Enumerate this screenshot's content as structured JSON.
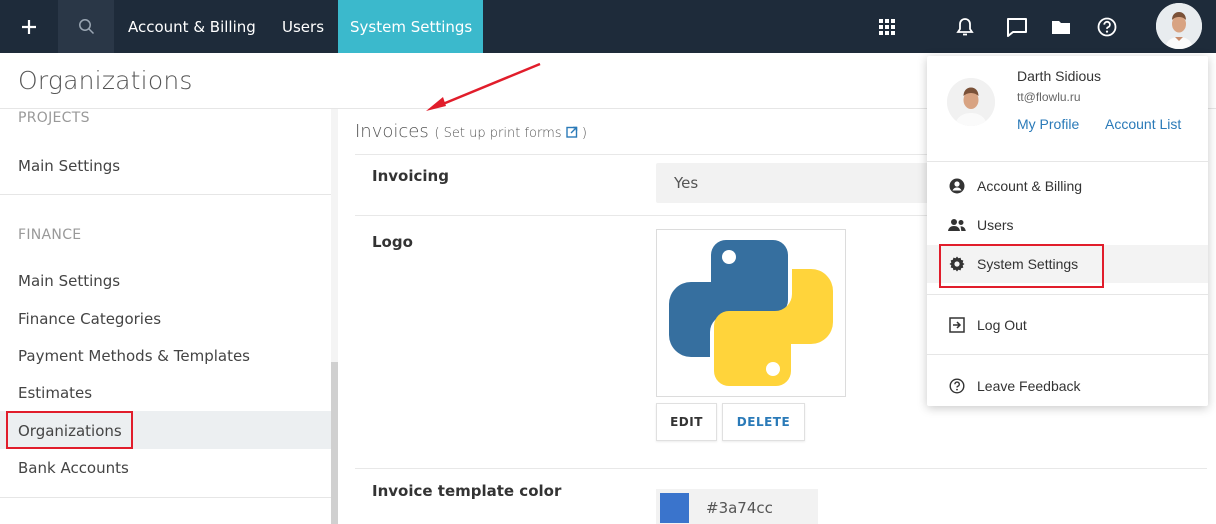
{
  "topbar": {
    "nav": [
      {
        "label": "Account & Billing"
      },
      {
        "label": "Users"
      },
      {
        "label": "System Settings",
        "active": true
      }
    ],
    "icons": [
      "plus-icon",
      "search-icon",
      "apps-grid-icon",
      "bell-icon",
      "chat-icon",
      "folder-icon",
      "help-icon"
    ],
    "accent": "#3bb9cc",
    "background": "#1e2b3a"
  },
  "page": {
    "title": "Organizations"
  },
  "sidebar": {
    "sections": [
      {
        "title": "PROJECTS",
        "items": [
          "Main Settings"
        ]
      },
      {
        "title": "FINANCE",
        "items": [
          "Main Settings",
          "Finance Categories",
          "Payment Methods & Templates",
          "Estimates",
          "Organizations",
          "Bank Accounts"
        ]
      }
    ],
    "active_item": "Organizations"
  },
  "main": {
    "section_title": "Invoices",
    "section_subtitle_open": "( Set up print forms",
    "section_subtitle_close": ")",
    "fields": {
      "invoicing": {
        "label": "Invoicing",
        "value": "Yes"
      },
      "logo": {
        "label": "Logo",
        "edit_label": "EDIT",
        "delete_label": "DELETE"
      },
      "color": {
        "label": "Invoice template color",
        "value": "#3a74cc"
      }
    }
  },
  "dropdown": {
    "user_name": "Darth Sidious",
    "email": "tt@flowlu.ru",
    "my_profile": "My Profile",
    "account_list": "Account List",
    "items": [
      {
        "label": "Account & Billing",
        "icon": "account-circle-icon"
      },
      {
        "label": "Users",
        "icon": "users-icon"
      },
      {
        "label": "System Settings",
        "icon": "gear-icon",
        "highlighted": true
      },
      {
        "label": "Log Out",
        "icon": "logout-icon"
      },
      {
        "label": "Leave Feedback",
        "icon": "help-circle-icon"
      }
    ],
    "link_color": "#2a7ab8"
  },
  "annotation_color": "#e11d2b"
}
